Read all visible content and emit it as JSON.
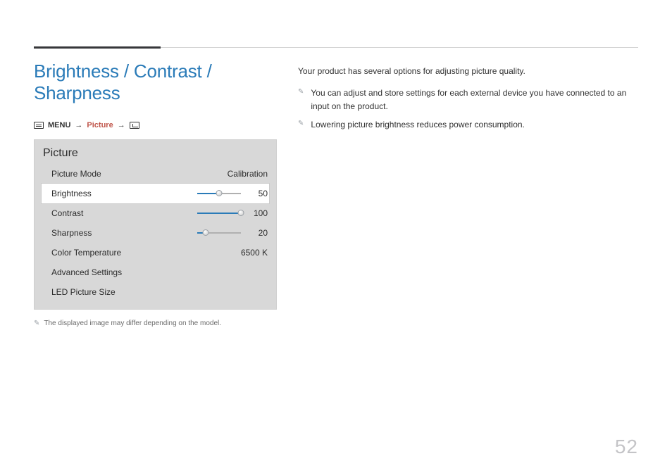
{
  "title": "Brightness / Contrast / Sharpness",
  "breadcrumb": {
    "menu": "MENU",
    "picture": "Picture"
  },
  "panel": {
    "title": "Picture",
    "picture_mode": {
      "label": "Picture Mode",
      "value": "Calibration"
    },
    "brightness": {
      "label": "Brightness",
      "value": "50",
      "pct": 50
    },
    "contrast": {
      "label": "Contrast",
      "value": "100",
      "pct": 100
    },
    "sharpness": {
      "label": "Sharpness",
      "value": "20",
      "pct": 20
    },
    "color_temp": {
      "label": "Color Temperature",
      "value": "6500 K"
    },
    "advanced": {
      "label": "Advanced Settings"
    },
    "led_size": {
      "label": "LED Picture Size"
    }
  },
  "left_note": "The displayed image may differ depending on the model.",
  "intro": "Your product has several options for adjusting picture quality.",
  "bullets": {
    "b0": "You can adjust and store settings for each external device you have connected to an input on the product.",
    "b1": "Lowering picture brightness reduces power consumption."
  },
  "page_number": "52"
}
